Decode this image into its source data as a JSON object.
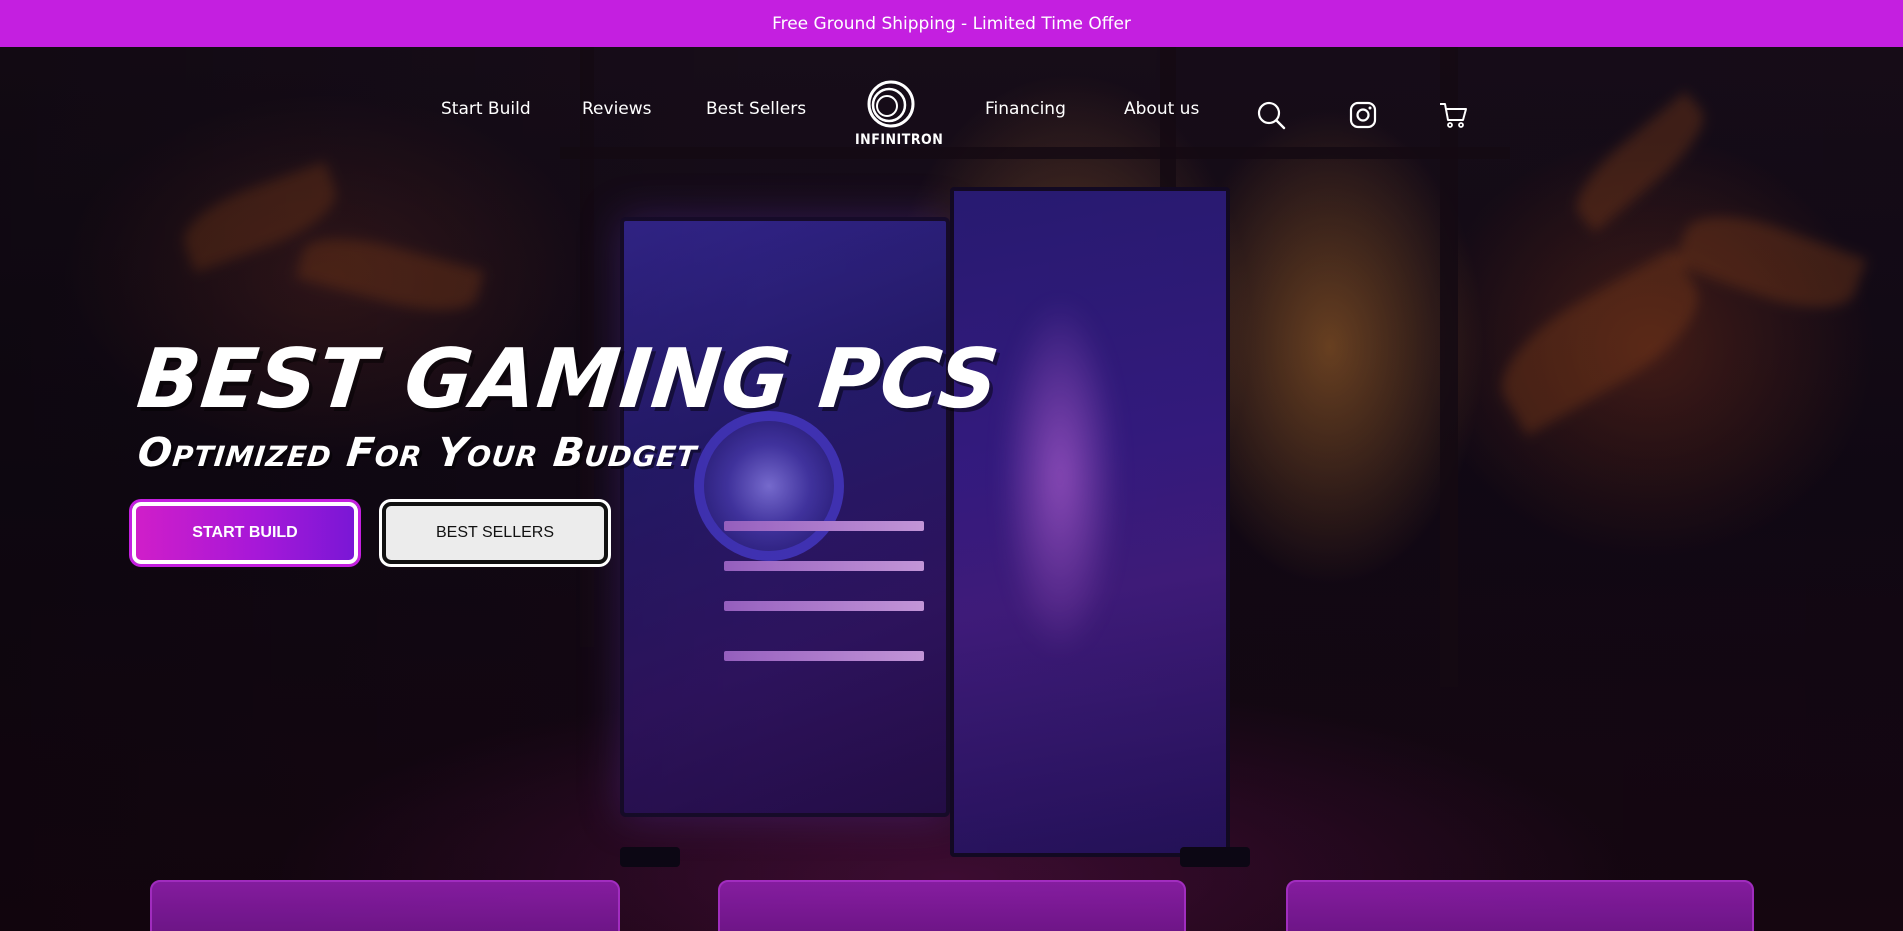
{
  "announcement": {
    "text": "Free Ground Shipping - Limited Time Offer"
  },
  "nav": {
    "left_links": [
      "Start Build",
      "Reviews",
      "Best Sellers"
    ],
    "right_links": [
      "Financing",
      "About us"
    ],
    "logo_text": "INFINITRON",
    "icons": [
      "search-icon",
      "instagram-icon",
      "cart-icon"
    ]
  },
  "hero": {
    "title": "BEST GAMING PCS",
    "subtitle": "Optimized For Your Budget",
    "primary_button": "START BUILD",
    "secondary_button": "BEST SELLERS"
  },
  "colors": {
    "accent": "#c41fe0",
    "button_gradient_start": "#d01ec9",
    "button_gradient_end": "#7a17d6",
    "card_purple": "#8a1ea6"
  }
}
